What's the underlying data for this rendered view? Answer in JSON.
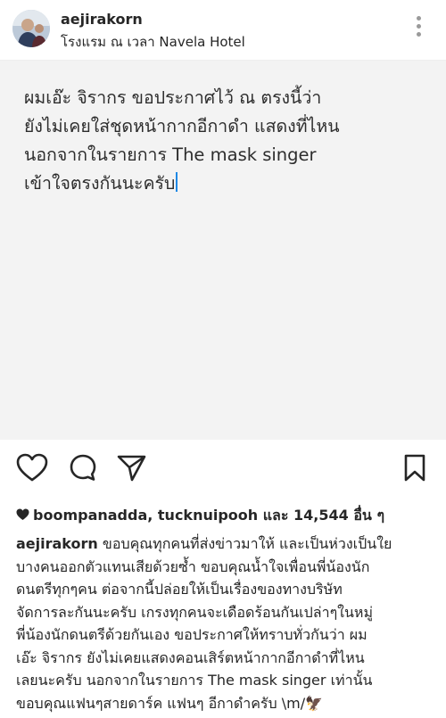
{
  "header": {
    "username": "aejirakorn",
    "location": "โรงแรม ณ เวลา Navela Hotel",
    "more_icon": "more-vertical-icon"
  },
  "post": {
    "image_text_lines": [
      "ผมเอ๊ะ จิรากร ขอประกาศไว้ ณ ตรงนี้ว่า",
      "ยังไม่เคยใส่ชุดหน้ากากอีกาดำ แสดงที่ไหน",
      "นอกจากในรายการ The mask singer",
      "เข้าใจตรงกันนะครับ"
    ],
    "background": "#f3f3f3"
  },
  "actions": {
    "icons": [
      "heart-icon",
      "comment-icon",
      "share-icon",
      "bookmark-icon"
    ]
  },
  "likes": {
    "text": "boompanadda, tucknuipooh และ 14,544 อื่น ๆ"
  },
  "caption": {
    "username": "aejirakorn",
    "first_line": "ขอบคุณทุกคนที่ส่งข่าวมาให้ และเป็นห่วงเป็นใย",
    "lines": [
      "บางคนออกตัวแทนเสียด้วยซ้ำ ขอบคุณน้ำใจเพื่อนพี่น้องนัก",
      "ดนตรีทุกๆคน ต่อจากนี้ปล่อยให้เป็นเรื่องของทางบริษัท",
      "จัดการละกันนะครับ เกรงทุกคนจะเดือดร้อนกันเปล่าๆในหมู่",
      "พี่น้องนักดนตรีด้วยกันเอง ขอประกาศให้ทราบทั่วกันว่า ผม",
      "เอ๊ะ จิรากร ยังไม่เคยแสดงคอนเสิร์ตหน้ากากอีกาดำที่ไหน",
      "เลยนะครับ นอกจากในรายการ The mask singer เท่านั้น",
      "ขอบคุณแฟนๆสายดาร์ค แฟนๆ อีกาดำครับ \\m/🦅"
    ]
  }
}
